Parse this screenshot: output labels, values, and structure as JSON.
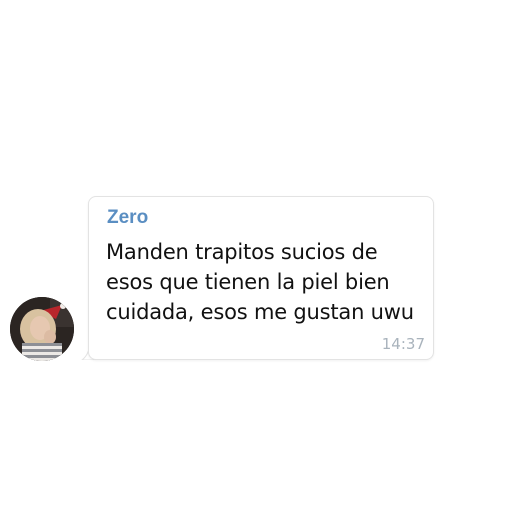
{
  "message": {
    "sender_name": "Zero",
    "text": "Manden trapitos sucios de esos que tienen la piel bien cuidada, esos me gustan uwu",
    "time": "14:37"
  },
  "avatar": {
    "icon": "user-photo-avatar"
  },
  "colors": {
    "sender_name": "#5a8ec2",
    "message_text": "#111111",
    "timestamp": "#a9b3bc",
    "bubble_border": "#e3e3e3",
    "background": "#ffffff"
  }
}
